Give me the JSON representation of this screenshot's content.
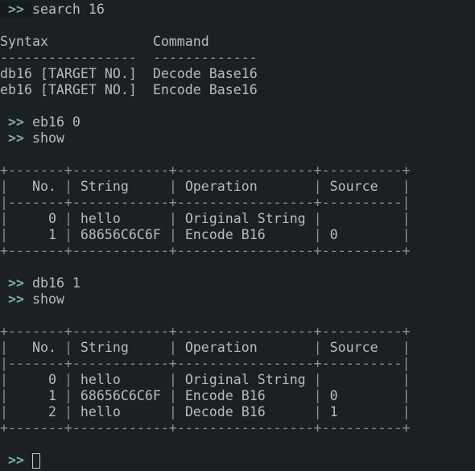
{
  "prompt_symbol": ">>",
  "search": {
    "command": "search 16",
    "headers": [
      "Syntax",
      "Command"
    ],
    "rows": [
      [
        "db16 [TARGET NO.]",
        "Decode Base16"
      ],
      [
        "eb16 [TARGET NO.]",
        "Encode Base16"
      ]
    ]
  },
  "block1": {
    "commands": [
      "eb16 0",
      "show"
    ],
    "table": {
      "headers": [
        "No.",
        "String",
        "Operation",
        "Source"
      ],
      "rows": [
        [
          "0",
          "hello",
          "Original String",
          ""
        ],
        [
          "1",
          "68656C6C6F",
          "Encode B16",
          "0"
        ]
      ]
    }
  },
  "block2": {
    "commands": [
      "db16 1",
      "show"
    ],
    "table": {
      "headers": [
        "No.",
        "String",
        "Operation",
        "Source"
      ],
      "rows": [
        [
          "0",
          "hello",
          "Original String",
          ""
        ],
        [
          "1",
          "68656C6C6F",
          "Encode B16",
          "0"
        ],
        [
          "2",
          "hello",
          "Decode B16",
          "1"
        ]
      ]
    }
  },
  "input": {
    "value": ""
  }
}
